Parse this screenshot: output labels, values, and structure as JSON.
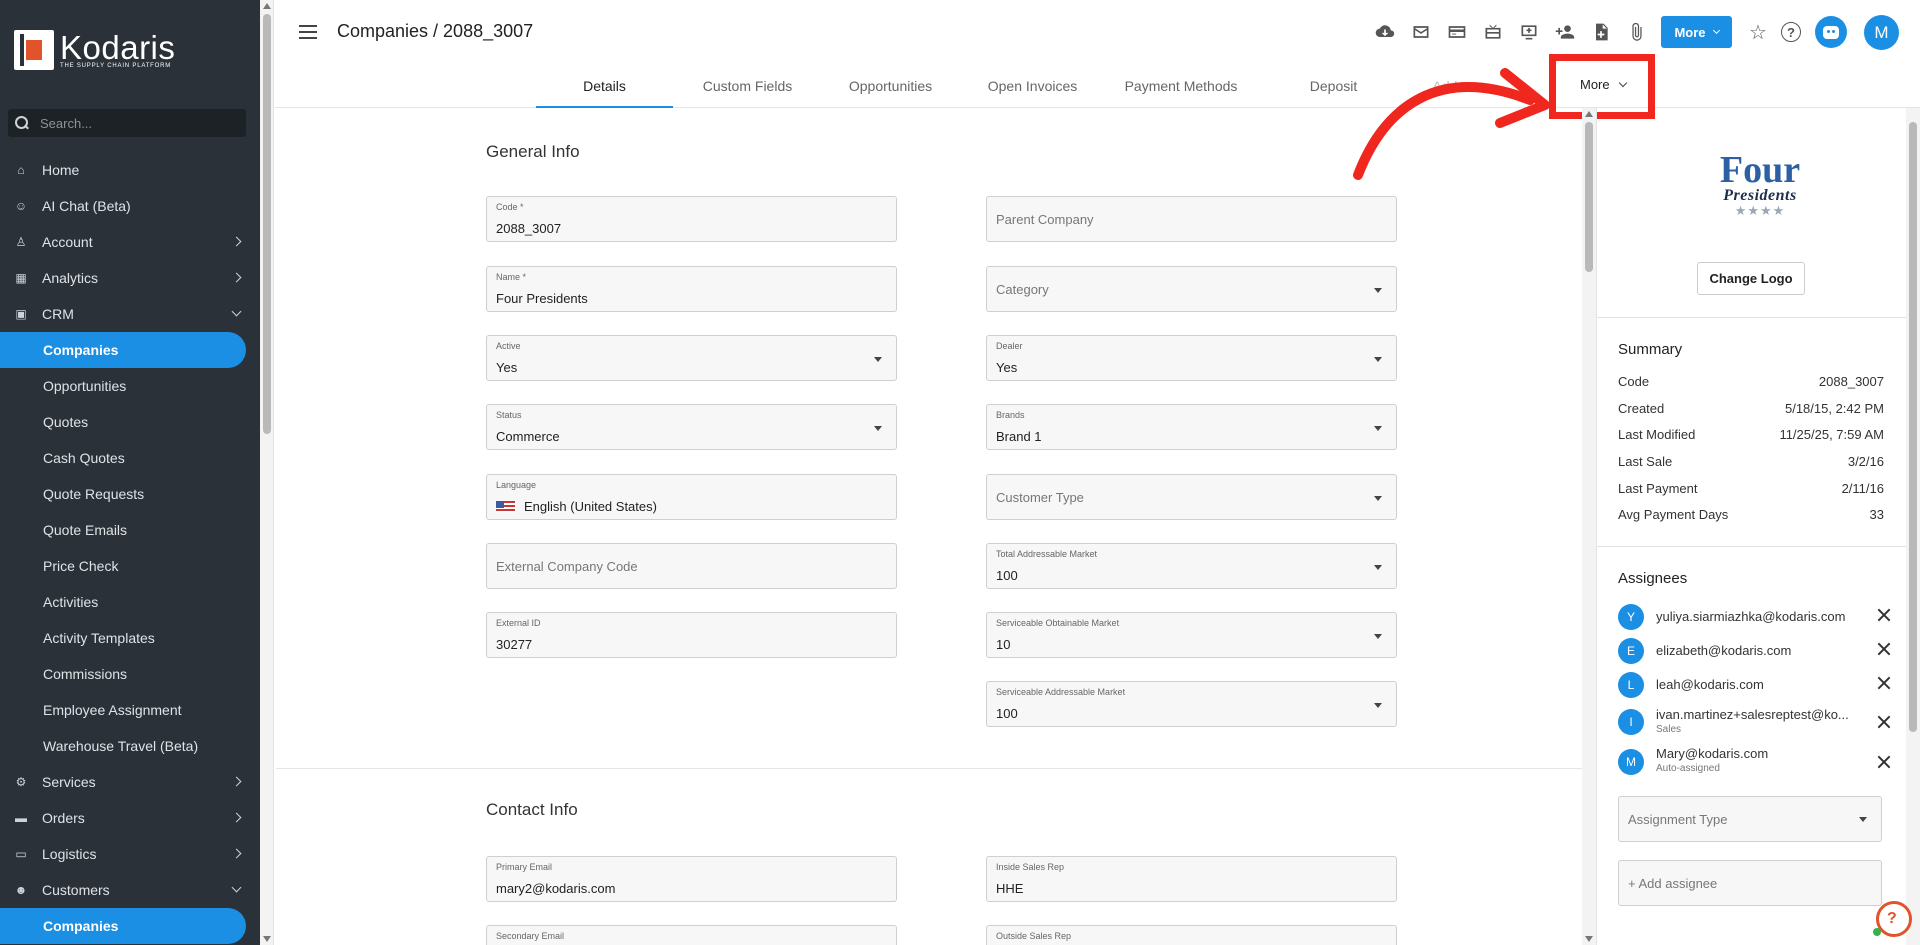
{
  "brand": {
    "name": "Kodaris",
    "tagline": "THE SUPPLY CHAIN PLATFORM"
  },
  "search": {
    "placeholder": "Search..."
  },
  "sidebar": {
    "items": [
      {
        "label": "Home",
        "icon": "home-icon"
      },
      {
        "label": "AI Chat (Beta)",
        "icon": "robot-icon"
      },
      {
        "label": "Account",
        "icon": "person-icon"
      },
      {
        "label": "Analytics",
        "icon": "chart-icon"
      },
      {
        "label": "CRM",
        "icon": "contact-card-icon"
      },
      {
        "label": "Companies"
      },
      {
        "label": "Opportunities"
      },
      {
        "label": "Quotes"
      },
      {
        "label": "Cash Quotes"
      },
      {
        "label": "Quote Requests"
      },
      {
        "label": "Quote Emails"
      },
      {
        "label": "Price Check"
      },
      {
        "label": "Activities"
      },
      {
        "label": "Activity Templates"
      },
      {
        "label": "Commissions"
      },
      {
        "label": "Employee Assignment"
      },
      {
        "label": "Warehouse Travel (Beta)"
      },
      {
        "label": "Services",
        "icon": "gear-icon"
      },
      {
        "label": "Orders",
        "icon": "truck-icon"
      },
      {
        "label": "Logistics",
        "icon": "shipping-icon"
      },
      {
        "label": "Customers",
        "icon": "group-icon"
      },
      {
        "label": "Companies"
      }
    ]
  },
  "header": {
    "title": "Companies / 2088_3007",
    "more_label": "More",
    "avatar_initial": "M"
  },
  "tabs": [
    {
      "label": "Details"
    },
    {
      "label": "Custom Fields"
    },
    {
      "label": "Opportunities"
    },
    {
      "label": "Open Invoices"
    },
    {
      "label": "Payment Methods"
    },
    {
      "label": "Deposit"
    },
    {
      "label": "Add"
    }
  ],
  "tab_more_label": "More",
  "general_info": {
    "title": "General Info",
    "code": {
      "label": "Code *",
      "value": "2088_3007"
    },
    "parent_company": {
      "placeholder": "Parent Company"
    },
    "name": {
      "label": "Name *",
      "value": "Four Presidents"
    },
    "category": {
      "placeholder": "Category"
    },
    "active": {
      "label": "Active",
      "value": "Yes"
    },
    "dealer": {
      "label": "Dealer",
      "value": "Yes"
    },
    "status": {
      "label": "Status",
      "value": "Commerce"
    },
    "brands": {
      "label": "Brands",
      "value": "Brand 1"
    },
    "language": {
      "label": "Language",
      "value": "English (United States)"
    },
    "customer_type": {
      "placeholder": "Customer Type"
    },
    "external_company_code": {
      "placeholder": "External Company Code"
    },
    "tam": {
      "label": "Total Addressable Market",
      "value": "100"
    },
    "external_id": {
      "label": "External ID",
      "value": "30277"
    },
    "som": {
      "label": "Serviceable Obtainable Market",
      "value": "10"
    },
    "sam": {
      "label": "Serviceable Addressable Market",
      "value": "100"
    }
  },
  "contact_info": {
    "title": "Contact Info",
    "primary_email": {
      "label": "Primary Email",
      "value": "mary2@kodaris.com"
    },
    "inside_sales_rep": {
      "label": "Inside Sales Rep",
      "value": "HHE"
    },
    "secondary_email": {
      "label": "Secondary Email"
    },
    "outside_sales_rep": {
      "label": "Outside Sales Rep"
    }
  },
  "company_logo": {
    "line1": "Four",
    "line2": "Presidents",
    "stars": "★★★★"
  },
  "change_logo_label": "Change Logo",
  "summary": {
    "title": "Summary",
    "rows": [
      {
        "label": "Code",
        "value": "2088_3007"
      },
      {
        "label": "Created",
        "value": "5/18/15, 2:42 PM"
      },
      {
        "label": "Last Modified",
        "value": "11/25/25, 7:59 AM"
      },
      {
        "label": "Last Sale",
        "value": "3/2/16"
      },
      {
        "label": "Last Payment",
        "value": "2/11/16"
      },
      {
        "label": "Avg Payment Days",
        "value": "33"
      }
    ]
  },
  "assignees": {
    "title": "Assignees",
    "items": [
      {
        "initial": "Y",
        "email": "yuliya.siarmiazhka@kodaris.com",
        "role": ""
      },
      {
        "initial": "E",
        "email": "elizabeth@kodaris.com",
        "role": ""
      },
      {
        "initial": "L",
        "email": "leah@kodaris.com",
        "role": ""
      },
      {
        "initial": "I",
        "email": "ivan.martinez+salesreptest@ko...",
        "role": "Sales"
      },
      {
        "initial": "M",
        "email": "Mary@kodaris.com",
        "role": "Auto-assigned"
      }
    ],
    "assignment_type_placeholder": "Assignment Type",
    "add_placeholder": "+ Add assignee"
  },
  "colors": {
    "accent": "#1a8fe3",
    "sidebar": "#2b3138",
    "highlight": "#f0271f",
    "brand_orange": "#e2522b"
  }
}
